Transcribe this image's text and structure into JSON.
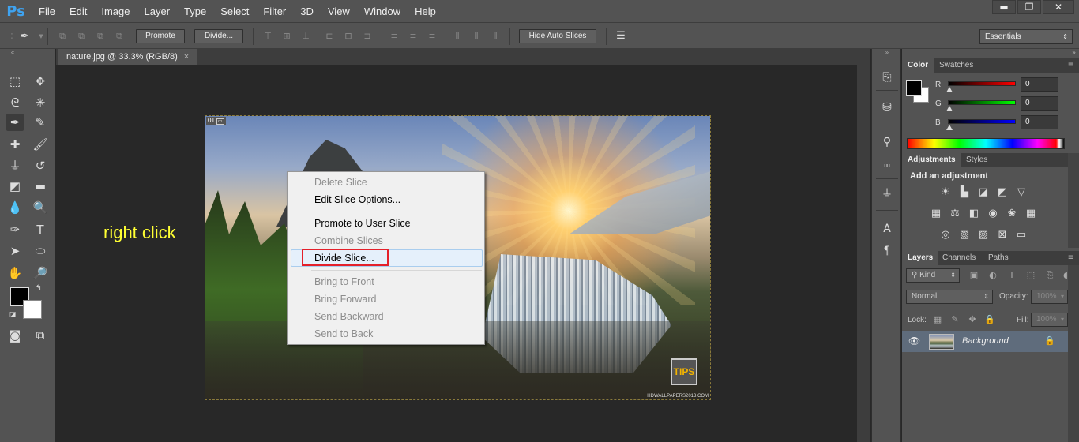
{
  "app": {
    "logo": "Ps"
  },
  "menu": [
    "File",
    "Edit",
    "Image",
    "Layer",
    "Type",
    "Select",
    "Filter",
    "3D",
    "View",
    "Window",
    "Help"
  ],
  "window_buttons": {
    "minimize": "▬",
    "restore": "❐",
    "close": "✕"
  },
  "options_bar": {
    "promote_label": "Promote",
    "divide_label": "Divide...",
    "hide_auto_slices_label": "Hide Auto Slices",
    "workspace": "Essentials"
  },
  "document_tab": {
    "title": "nature.jpg @ 33.3% (RGB/8)",
    "close": "×"
  },
  "image": {
    "slice_number": "01",
    "badge": "TIPS",
    "credit": "HDWALLPAPERS2013.COM"
  },
  "annotation": {
    "text": "right click",
    "color": "#ffff33"
  },
  "context_menu": {
    "items": [
      {
        "label": "Delete Slice",
        "enabled": false
      },
      {
        "label": "Edit Slice Options...",
        "enabled": true
      },
      {
        "label": "Promote to User Slice",
        "enabled": true
      },
      {
        "label": "Combine Slices",
        "enabled": false
      },
      {
        "label": "Divide Slice...",
        "enabled": true,
        "highlighted": true
      },
      {
        "label": "Bring to Front",
        "enabled": false
      },
      {
        "label": "Bring Forward",
        "enabled": false
      },
      {
        "label": "Send Backward",
        "enabled": false
      },
      {
        "label": "Send to Back",
        "enabled": false
      }
    ],
    "highlight_color": "#e4202a"
  },
  "color_panel": {
    "tabs": [
      "Color",
      "Swatches"
    ],
    "channels": [
      {
        "label": "R",
        "value": "0",
        "color": "#e00000"
      },
      {
        "label": "G",
        "value": "0",
        "color": "#00c000"
      },
      {
        "label": "B",
        "value": "0",
        "color": "#0000e0"
      }
    ]
  },
  "adjustments_panel": {
    "tabs": [
      "Adjustments",
      "Styles"
    ],
    "title": "Add an adjustment"
  },
  "layers_panel": {
    "tabs": [
      "Layers",
      "Channels",
      "Paths"
    ],
    "filter_kind": "Kind",
    "blend_mode": "Normal",
    "opacity_label": "Opacity:",
    "opacity_value": "100%",
    "lock_label": "Lock:",
    "fill_label": "Fill:",
    "fill_value": "100%",
    "layers": [
      {
        "name": "Background",
        "locked": true,
        "visible": true
      }
    ]
  }
}
